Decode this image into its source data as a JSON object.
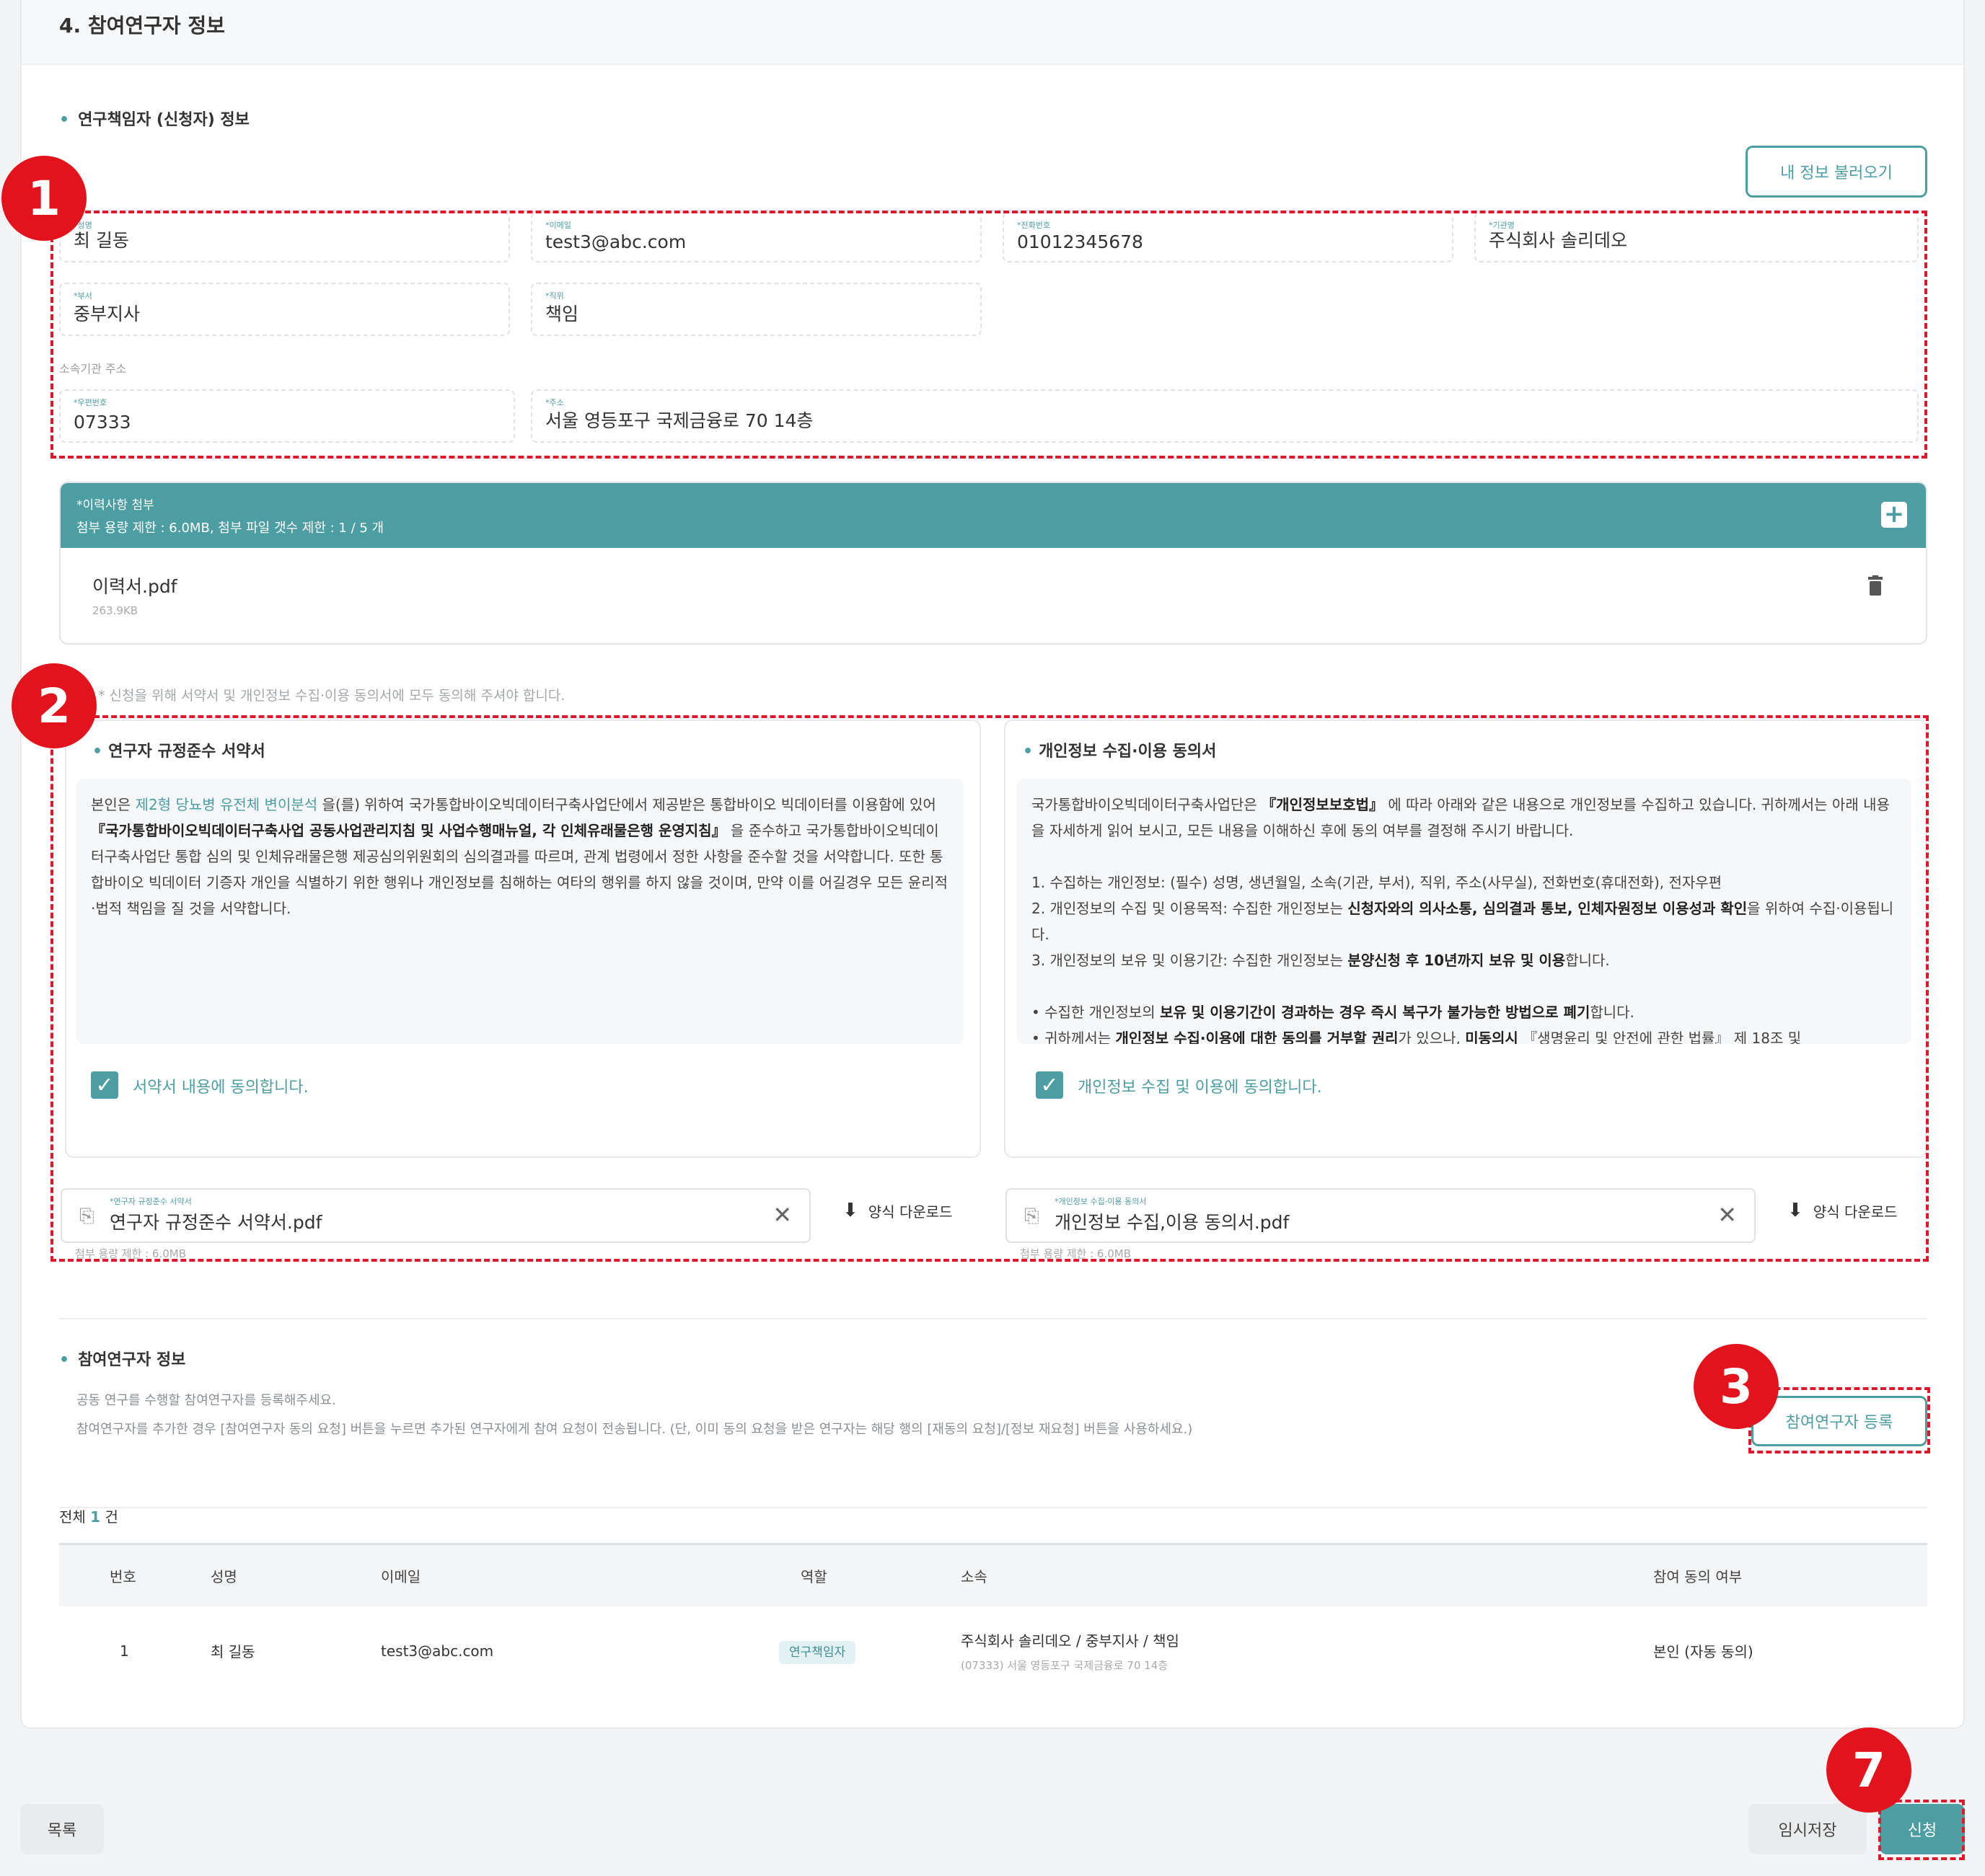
{
  "section": {
    "title": "4. 참여연구자 정보"
  },
  "pi": {
    "label": "연구책임자 (신청자) 정보",
    "load_button": "내 정보 불러오기",
    "fields": {
      "name": {
        "label": "*성명",
        "value": "최 길동"
      },
      "email": {
        "label": "*이메일",
        "value": "test3@abc.com"
      },
      "phone": {
        "label": "*전화번호",
        "value": "01012345678"
      },
      "org": {
        "label": "*기관명",
        "value": "주식회사 솔리데오"
      },
      "dept": {
        "label": "*부서",
        "value": "중부지사"
      },
      "position": {
        "label": "*직위",
        "value": "책임"
      },
      "postcode": {
        "label": "*우편번호",
        "value": "07333"
      },
      "address": {
        "label": "*주소",
        "value": "서울 영등포구 국제금융로 70  14층"
      }
    },
    "org_address_label": "소속기관 주소"
  },
  "resume": {
    "title": "*이력사항 첨부",
    "limit": "첨부 용량 제한 : 6.0MB, 첨부 파일 갯수 제한 : 1 / 5 개",
    "file_name": "이력서.pdf",
    "file_size": "263.9KB"
  },
  "consent": {
    "notice": "* 신청을 위해 서약서 및 개인정보 수집·이용 동의서에 모두 동의해 주셔야 합니다.",
    "pledge": {
      "title": "연구자 규정준수 서약서",
      "p1": "본인은 ",
      "p1_link": "제2형 당뇨병 유전체 변이분석",
      "p2": " 을(를) 위하여 국가통합바이오빅데이터구축사업단에서 제공받은 통합바이오 빅데이터를 이용함에 있어 ",
      "p2_bold": "『국가통합바이오빅데이터구축사업 공동사업관리지침 및 사업수행매뉴얼, 각 인체유래물은행 운영지침』",
      "p3": " 을 준수하고 국가통합바이오빅데이터구축사업단 통합 심의 및 인체유래물은행 제공심의위원회의 심의결과를 따르며, 관계 법령에서 정한 사항을 준수할 것을 서약합니다. 또한 통합바이오 빅데이터 기증자 개인을 식별하기 위한 행위나 개인정보를 침해하는 여타의 행위를 하지 않을 것이며, 만약 이를 어길경우 모든 윤리적·법적 책임을 질 것을 서약합니다.",
      "check_label": "서약서 내용에 동의합니다.",
      "file_label": "*연구자 규정준수 서약서",
      "file_name": "연구자 규정준수 서약서.pdf",
      "download": "양식 다운로드",
      "limit": "첨부 용량 제한 : 6.0MB"
    },
    "privacy": {
      "title": "개인정보 수집·이용 동의서",
      "intro1": "국가통합바이오빅데이터구축사업단은 ",
      "intro_bold": "『개인정보보호법』",
      "intro2": " 에 따라 아래와 같은 내용으로 개인정보를 수집하고 있습니다. 귀하께서는 아래 내용을 자세하게 읽어 보시고, 모든 내용을 이해하신 후에 동의 여부를 결정해 주시기 바랍니다.",
      "item1": "1. 수집하는 개인정보: (필수) 성명, 생년월일, 소속(기관, 부서), 직위, 주소(사무실), 전화번호(휴대전화), 전자우편",
      "item2a": "2. 개인정보의 수집 및 이용목적: 수집한 개인정보는 ",
      "item2_bold": "신청자와의 의사소통, 심의결과 통보, 인체자원정보 이용성과 확인",
      "item2b": "을 위하여 수집·이용됩니다.",
      "item3a": "3. 개인정보의 보유 및 이용기간: 수집한 개인정보는 ",
      "item3_bold": "분양신청 후 10년까지 보유 및 이용",
      "item3b": "합니다.",
      "bullet1a": "• 수집한 개인정보의 ",
      "bullet1_bold": "보유 및 이용기간이 경과하는 경우 즉시 복구가 불가능한 방법으로 폐기",
      "bullet1b": "합니다.",
      "bullet2a": "• 귀하께서는 ",
      "bullet2_bold": "개인정보 수집·이용에 대한 동의를 거부할 권리",
      "bullet2b": "가 있으나, ",
      "bullet2_bold2": "미동의시",
      "bullet2c": " 『생명윤리 및 안전에 관한 법률』 제 18조 및",
      "check_label": "개인정보 수집 및 이용에 동의합니다.",
      "file_label": "*개인정보 수집·이용 동의서",
      "file_name": "개인정보 수집,이용 동의서.pdf",
      "download": "양식 다운로드",
      "limit": "첨부 용량 제한 : 6.0MB"
    }
  },
  "members": {
    "label": "참여연구자 정보",
    "desc1": "공동 연구를 수행할 참여연구자를 등록해주세요.",
    "desc2": "참여연구자를 추가한 경우 [참여연구자 동의 요청] 버튼을 누르면 추가된 연구자에게 참여 요청이 전송됩니다. (단, 이미 동의 요청을 받은 연구자는 해당 행의 [재동의 요청]/[정보 재요청] 버튼을 사용하세요.)",
    "register_button": "참여연구자 등록",
    "total_prefix": "전체 ",
    "total_count": "1",
    "total_suffix": " 건",
    "columns": [
      "번호",
      "성명",
      "이메일",
      "역할",
      "소속",
      "참여 동의 여부"
    ],
    "rows": [
      {
        "no": "1",
        "name": "최 길동",
        "email": "test3@abc.com",
        "role": "연구책임자",
        "affil": "주식회사 솔리데오 / 중부지사 / 책임",
        "addr": "(07333) 서울 영등포구 국제금융로 70 14층",
        "consent": "본인 (자동 동의)"
      }
    ]
  },
  "footer": {
    "list_button": "목록",
    "save_button": "임시저장",
    "submit_button": "신청"
  },
  "markers": [
    "1",
    "2",
    "3",
    "7"
  ],
  "colors": {
    "accent": "#4d9ea3",
    "highlight": "#e0182b",
    "marker": "#e3131d"
  }
}
